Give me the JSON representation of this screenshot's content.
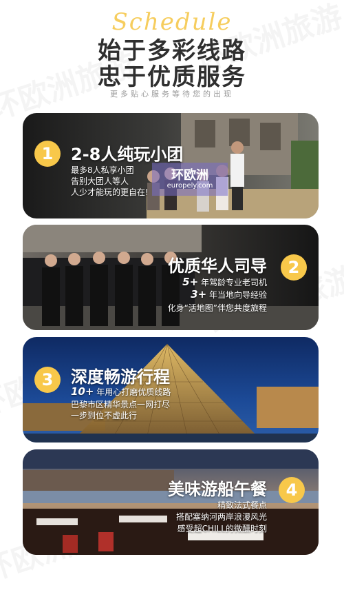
{
  "header": {
    "script_text": "Schedule",
    "title_line1": "始于多彩线路",
    "title_line2": "忠于优质服务",
    "subtitle": "更多贴心服务等待您的出现"
  },
  "watermark": "环欧洲旅游",
  "colors": {
    "accent": "#f8c84a",
    "title": "#2f2f2f"
  },
  "cards": [
    {
      "number": "1",
      "title": "2-8人纯玩小团",
      "lines": [
        "最多8人私享小团",
        "告别大团人等人",
        "人少才能玩的更自在!"
      ],
      "banner_title": "环欧洲",
      "banner_url": "europely.com"
    },
    {
      "number": "2",
      "title": "优质华人司导",
      "line1_num": "5+",
      "line1_text": "年驾龄专业老司机",
      "line2_num": "3+",
      "line2_text": "年当地向导经验",
      "line3": "化身“活地图”伴您共度旅程"
    },
    {
      "number": "3",
      "title": "深度畅游行程",
      "line1_num": "10+",
      "line1_text": "年用心打磨优质线路",
      "line2": "巴黎市区精华景点一网打尽",
      "line3": "一步到位不虚此行"
    },
    {
      "number": "4",
      "title": "美味游船午餐",
      "lines": [
        "精致法式餐点",
        "搭配塞纳河两岸浪漫风光",
        "感受超CHILL的微醺时刻"
      ]
    }
  ]
}
